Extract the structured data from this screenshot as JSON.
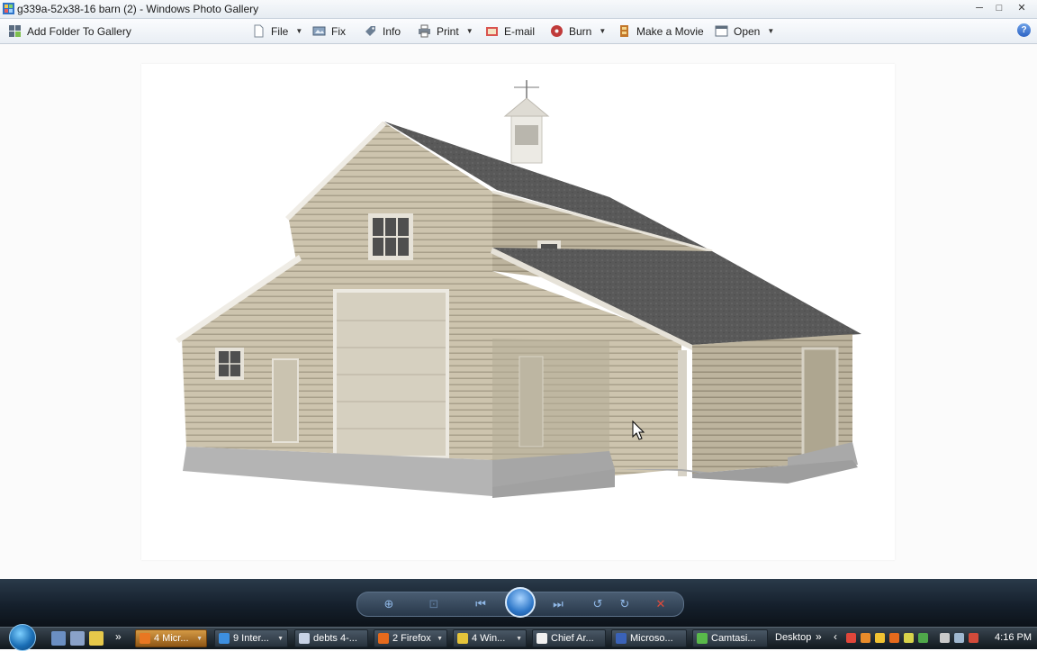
{
  "window": {
    "title": "g339a-52x38-16 barn (2) - Windows Photo Gallery",
    "buttons": {
      "minimize": "─",
      "maximize": "□",
      "close": "✕"
    }
  },
  "menubar": {
    "add_folder": "Add Folder To Gallery",
    "file": "File",
    "fix": "Fix",
    "info": "Info",
    "print": "Print",
    "email": "E-mail",
    "burn": "Burn",
    "make_movie": "Make a Movie",
    "open": "Open",
    "help": "?"
  },
  "photo": {
    "subject": "barn rendering",
    "colors": {
      "siding": "#ccc3ad",
      "roof": "#5c5c5c",
      "foundation": "#b2b2b2",
      "trim": "#e9e6de"
    }
  },
  "controls": {
    "items": [
      "zoom-icon",
      "actual-size-icon",
      "previous-icon",
      "slideshow-icon",
      "next-icon",
      "rotate-left-icon",
      "rotate-right-icon",
      "delete-icon"
    ]
  },
  "taskbar": {
    "buttons": [
      {
        "label": "4 Micr...",
        "color": "#e87722"
      },
      {
        "label": "9 Inter...",
        "color": "#3d8fe0"
      },
      {
        "label": "debts 4-...",
        "color": "#c8d3e6"
      },
      {
        "label": "2 Firefox",
        "color": "#e66a1c"
      },
      {
        "label": "4 Win...",
        "color": "#e5c43a"
      },
      {
        "label": "Chief Ar...",
        "color": "#f0f0f0"
      },
      {
        "label": "Microso...",
        "color": "#3a62b8"
      },
      {
        "label": "Camtasi...",
        "color": "#59b94a"
      }
    ],
    "desktop_label": "Desktop",
    "clock": "4:16 PM"
  }
}
